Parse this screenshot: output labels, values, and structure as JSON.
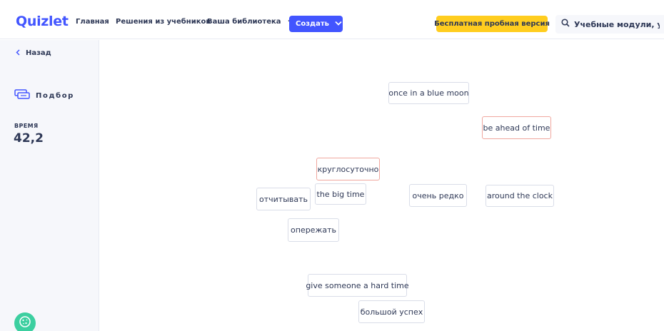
{
  "header": {
    "logo": "Quizlet",
    "nav": {
      "home": "Главная",
      "solutions": "Решения из учебников",
      "library": "Ваша библиотека"
    },
    "create_label": "Создать",
    "trial_label": "Бесплатная пробная версия",
    "search_placeholder": "Учебные модули, у..."
  },
  "sidebar": {
    "back_label": "Назад",
    "mode_label": "Подбор",
    "time_label": "ВРЕМЯ",
    "time_value": "42,2"
  },
  "cards": [
    {
      "text": "once in a blue moon",
      "selected": false
    },
    {
      "text": "be ahead of time",
      "selected": true
    },
    {
      "text": "круглосуточно",
      "selected": true
    },
    {
      "text": "the big time",
      "selected": false
    },
    {
      "text": "отчитывать",
      "selected": false
    },
    {
      "text": "очень редко",
      "selected": false
    },
    {
      "text": "around the clock",
      "selected": false
    },
    {
      "text": "опережать",
      "selected": false
    },
    {
      "text": "give someone a hard time",
      "selected": false
    },
    {
      "text": "большой успех",
      "selected": false
    }
  ],
  "colors": {
    "brand": "#4255ff",
    "trial": "#ffcd1f",
    "selected_border": "#f0a79e",
    "cookie": "#3ccfa0"
  }
}
